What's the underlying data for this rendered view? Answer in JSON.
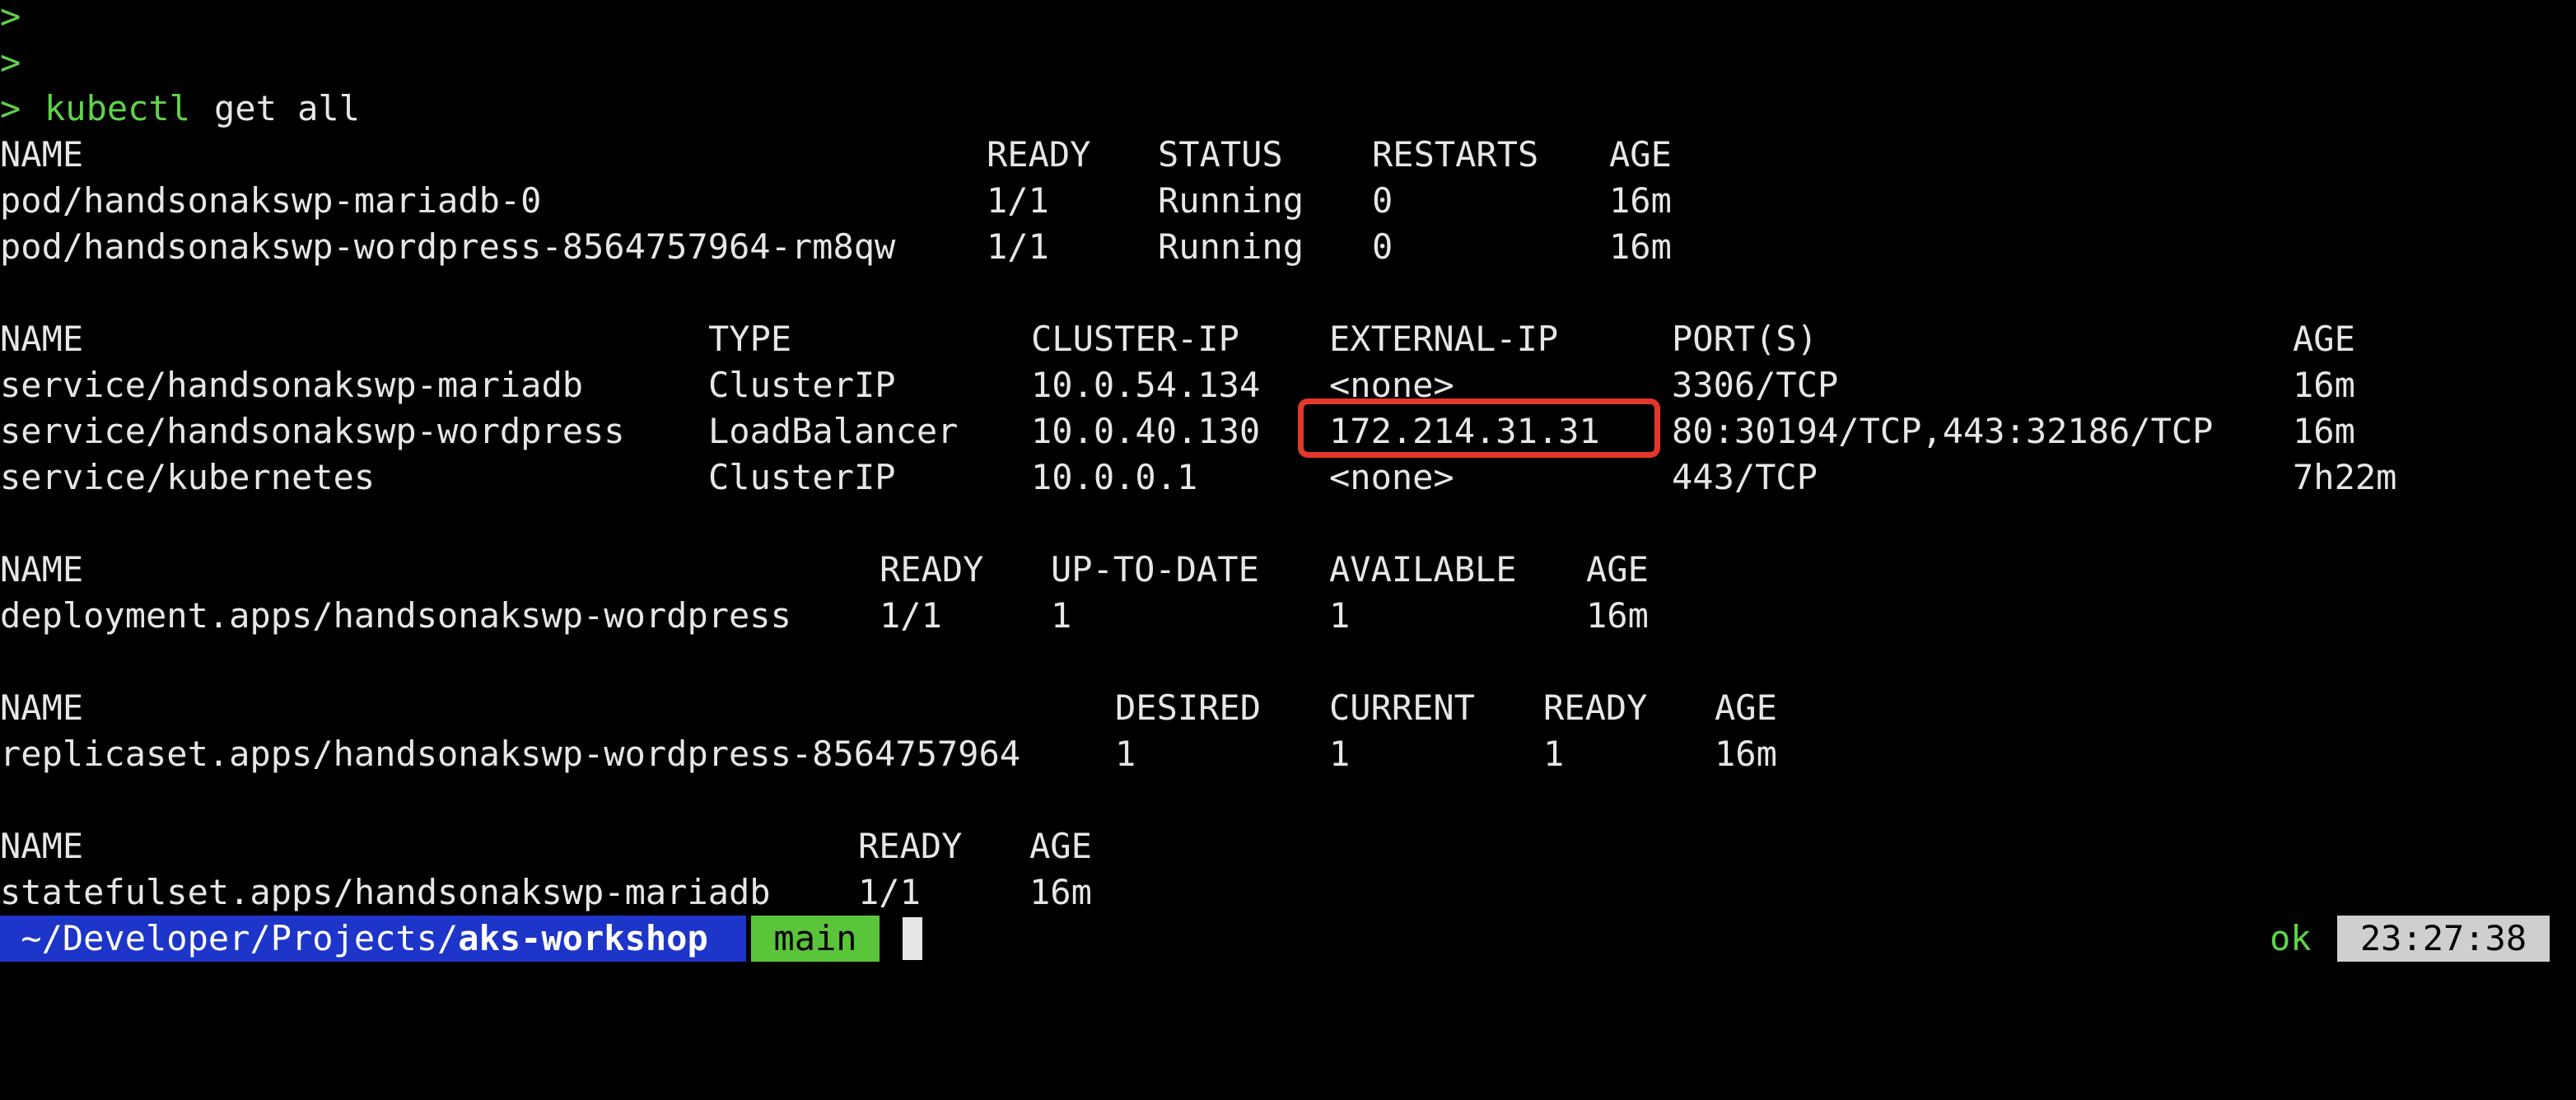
{
  "colors": {
    "background": "#000000",
    "text": "#e6e6e6",
    "prompt_green": "#5fd34a",
    "path_segment_bg": "#1d35c8",
    "branch_segment_bg": "#5ac43b",
    "clock_bg": "#cfcfcf",
    "highlight_box": "#e4372b"
  },
  "history": [
    ">",
    ">"
  ],
  "command": {
    "prompt": ">",
    "program": "kubectl",
    "args": "get all"
  },
  "pods": {
    "headers": [
      "NAME",
      "READY",
      "STATUS",
      "RESTARTS",
      "AGE"
    ],
    "rows": [
      [
        "pod/handsonakswp-mariadb-0",
        "1/1",
        "Running",
        "0",
        "16m"
      ],
      [
        "pod/handsonakswp-wordpress-8564757964-rm8qw",
        "1/1",
        "Running",
        "0",
        "16m"
      ]
    ]
  },
  "services": {
    "headers": [
      "NAME",
      "TYPE",
      "CLUSTER-IP",
      "EXTERNAL-IP",
      "PORT(S)",
      "AGE"
    ],
    "rows": [
      [
        "service/handsonakswp-mariadb",
        "ClusterIP",
        "10.0.54.134",
        "<none>",
        "3306/TCP",
        "16m"
      ],
      [
        "service/handsonakswp-wordpress",
        "LoadBalancer",
        "10.0.40.130",
        "172.214.31.31",
        "80:30194/TCP,443:32186/TCP",
        "16m"
      ],
      [
        "service/kubernetes",
        "ClusterIP",
        "10.0.0.1",
        "<none>",
        "443/TCP",
        "7h22m"
      ]
    ]
  },
  "deployments": {
    "headers": [
      "NAME",
      "READY",
      "UP-TO-DATE",
      "AVAILABLE",
      "AGE"
    ],
    "rows": [
      [
        "deployment.apps/handsonakswp-wordpress",
        "1/1",
        "1",
        "1",
        "16m"
      ]
    ]
  },
  "replicasets": {
    "headers": [
      "NAME",
      "DESIRED",
      "CURRENT",
      "READY",
      "AGE"
    ],
    "rows": [
      [
        "replicaset.apps/handsonakswp-wordpress-8564757964",
        "1",
        "1",
        "1",
        "16m"
      ]
    ]
  },
  "statefulsets": {
    "headers": [
      "NAME",
      "READY",
      "AGE"
    ],
    "rows": [
      [
        "statefulset.apps/handsonakswp-mariadb",
        "1/1",
        "16m"
      ]
    ]
  },
  "prompt_bar": {
    "path_prefix": " ~/Developer/Projects/",
    "path_current": "aks-workshop",
    "branch": "main",
    "status": "ok",
    "time": "23:27:38"
  }
}
